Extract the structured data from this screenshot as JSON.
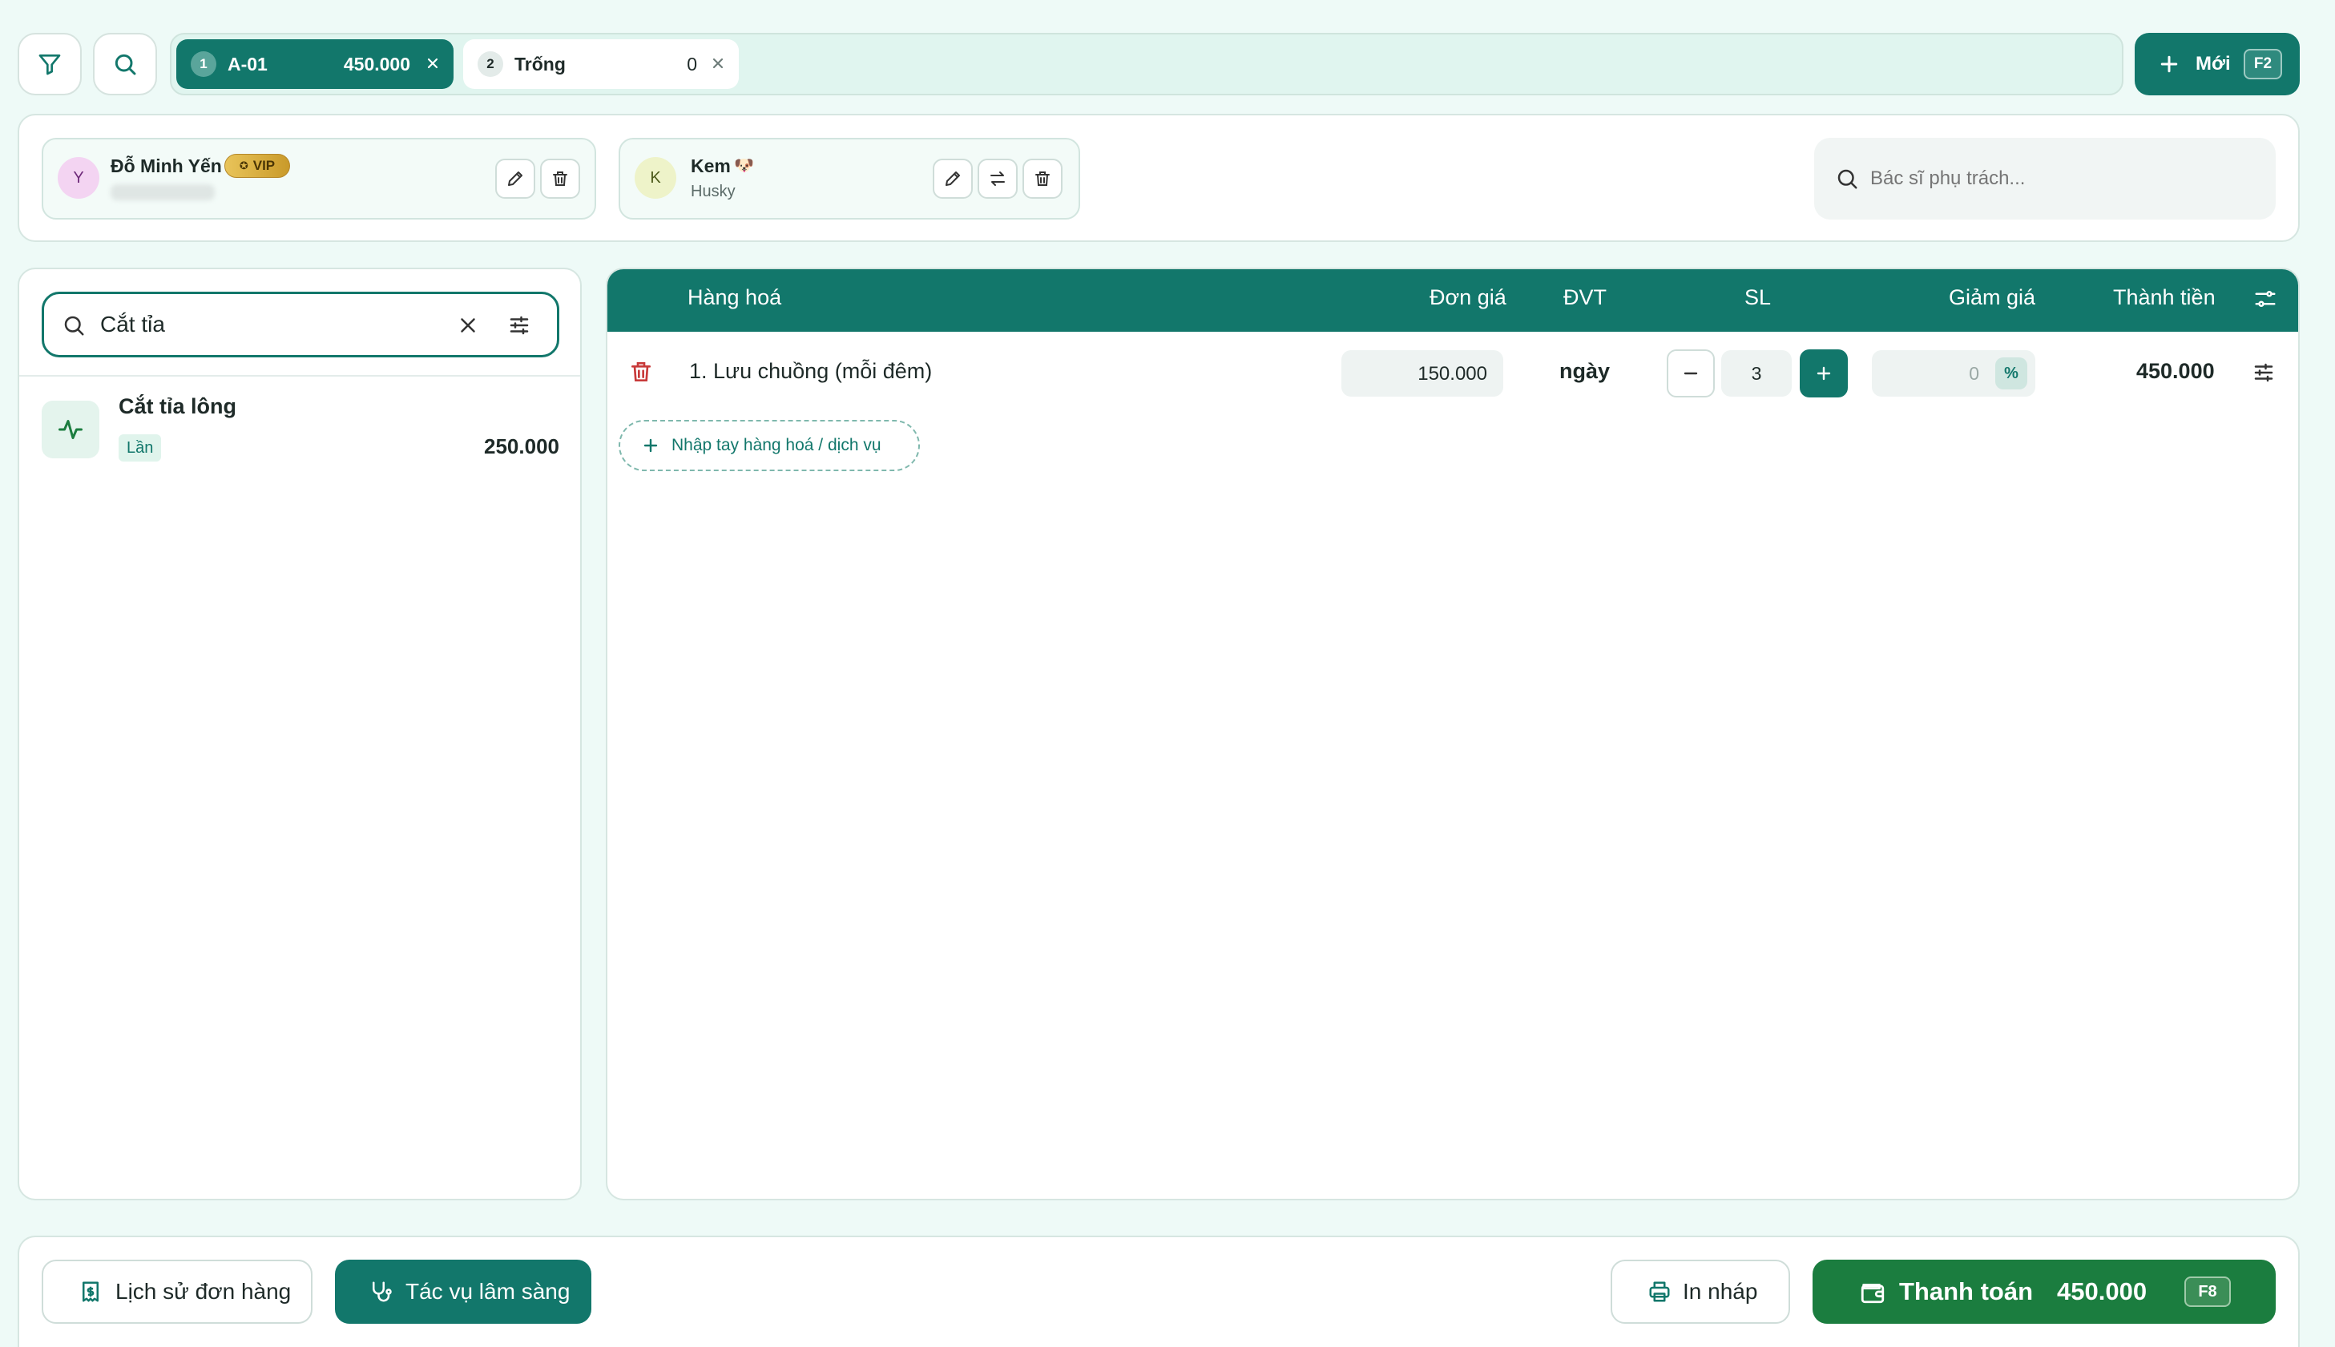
{
  "toolbar": {
    "filter_icon": "filter-icon",
    "search_icon": "search-icon",
    "new_label": "Mới",
    "new_shortcut": "F2"
  },
  "order_tabs": [
    {
      "index": "1",
      "name": "A-01",
      "amount": "450.000",
      "active": true
    },
    {
      "index": "2",
      "name": "Trống",
      "amount": "0",
      "active": false
    }
  ],
  "customer": {
    "initial": "Y",
    "name": "Đỗ Minh Yến",
    "badge": "VIP"
  },
  "pet": {
    "initial": "K",
    "name": "Kem",
    "emoji": "🐶",
    "breed": "Husky"
  },
  "doctor": {
    "placeholder": "Bác sĩ phụ trách..."
  },
  "catalog": {
    "search_value": "Cắt tỉa",
    "results": [
      {
        "name": "Cắt tỉa lông",
        "unit": "Lần",
        "price": "250.000"
      }
    ]
  },
  "cart": {
    "headers": {
      "product": "Hàng hoá",
      "unit_price": "Đơn giá",
      "unit": "ĐVT",
      "qty": "SL",
      "discount": "Giảm giá",
      "total": "Thành tiền"
    },
    "rows": [
      {
        "name": "1. Lưu chuồng (mỗi đêm)",
        "unit_price": "150.000",
        "unit": "ngày",
        "qty": "3",
        "discount": "0",
        "discount_mode": "%",
        "total": "450.000"
      }
    ],
    "manual_add_label": "Nhập tay hàng hoá / dịch vụ"
  },
  "footer": {
    "history_label": "Lịch sử đơn hàng",
    "clinical_label": "Tác vụ lâm sàng",
    "print_label": "In nháp",
    "pay_label": "Thanh toán",
    "pay_amount": "450.000",
    "pay_shortcut": "F8"
  },
  "colors": {
    "primary": "#12776b",
    "pay": "#1b7d3f",
    "background": "#eefaf7",
    "danger": "#c83a3a"
  }
}
